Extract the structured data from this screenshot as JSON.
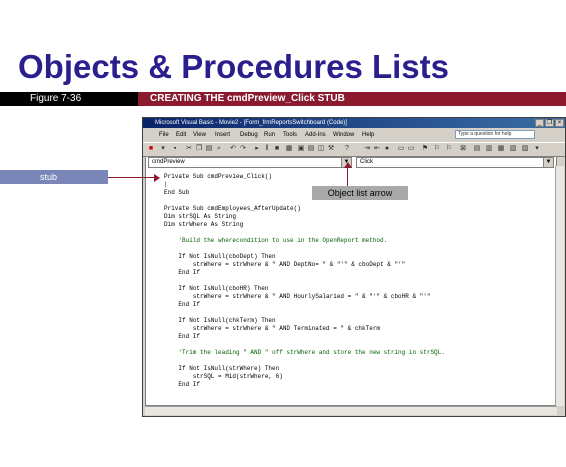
{
  "slide": {
    "title": "Objects & Procedures Lists",
    "figure_label": "Figure 7-36",
    "caption": "CREATING THE cmdPreview_Click STUB"
  },
  "window": {
    "title": "Microsoft Visual Basic - Movie2 - [Form_frmReportsSwitchboard (Code)]",
    "menu": [
      "File",
      "Edit",
      "View",
      "Insert",
      "Debug",
      "Run",
      "Tools",
      "Add-Ins",
      "Window",
      "Help"
    ],
    "help_placeholder": "Type a question for help",
    "controls": {
      "minimize": "_",
      "restore": "❐",
      "close": "×"
    }
  },
  "editor": {
    "object_list": "cmdPreview",
    "procedure_list": "Click",
    "code": [
      {
        "text": "Private Sub cmdPreview_Click()",
        "comment": false
      },
      {
        "text": "|",
        "comment": false
      },
      {
        "text": "End Sub",
        "comment": false
      },
      {
        "text": "",
        "comment": false
      },
      {
        "text": "Private Sub cmdEmployees_AfterUpdate()",
        "comment": false
      },
      {
        "text": "Dim strSQL As String",
        "comment": false
      },
      {
        "text": "Dim strWhere As String",
        "comment": false
      },
      {
        "text": "",
        "comment": false
      },
      {
        "text": "    'Build the wherecondition to use in the OpenReport method.",
        "comment": true
      },
      {
        "text": "",
        "comment": false
      },
      {
        "text": "    If Not IsNull(cboDept) Then",
        "comment": false
      },
      {
        "text": "        strWhere = strWhere & \" AND DeptNo= \" & \"'\" & cboDept & \"'\"",
        "comment": false
      },
      {
        "text": "    End If",
        "comment": false
      },
      {
        "text": "",
        "comment": false
      },
      {
        "text": "    If Not IsNull(cboHR) Then",
        "comment": false
      },
      {
        "text": "        strWhere = strWhere & \" AND HourlySalaried = \" & \"'\" & cboHR & \"'\"",
        "comment": false
      },
      {
        "text": "    End If",
        "comment": false
      },
      {
        "text": "",
        "comment": false
      },
      {
        "text": "    If Not IsNull(chkTerm) Then",
        "comment": false
      },
      {
        "text": "        strWhere = strWhere & \" AND Terminated = \" & chkTerm",
        "comment": false
      },
      {
        "text": "    End If",
        "comment": false
      },
      {
        "text": "",
        "comment": false
      },
      {
        "text": "    'Trim the leading \" AND \" off strWhere and store the new string in strSQL.",
        "comment": true
      },
      {
        "text": "",
        "comment": false
      },
      {
        "text": "    If Not IsNull(strWhere) Then",
        "comment": false
      },
      {
        "text": "        strSQL = Mid(strWhere, 6)",
        "comment": false
      },
      {
        "text": "    End If",
        "comment": false
      }
    ]
  },
  "callouts": {
    "stub": "stub",
    "object_list_arrow": "Object list arrow"
  }
}
